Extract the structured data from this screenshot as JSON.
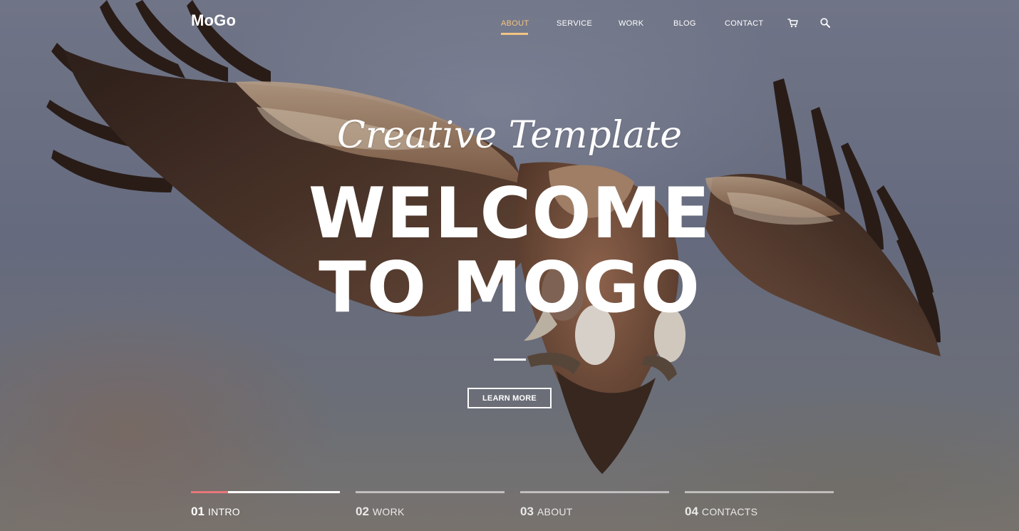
{
  "header": {
    "logo": "MoGo",
    "nav": [
      {
        "label": "ABOUT",
        "active": true
      },
      {
        "label": "SERVICE",
        "active": false
      },
      {
        "label": "WORK",
        "active": false
      },
      {
        "label": "BLOG",
        "active": false
      },
      {
        "label": "CONTACT",
        "active": false
      }
    ],
    "icons": [
      "cart-icon",
      "search-icon"
    ]
  },
  "hero": {
    "tagline": "Creative Template",
    "headline_line1": "WELCOME",
    "headline_line2": "TO MOGO",
    "button_label": "LEARN MORE"
  },
  "slides": [
    {
      "number": "01",
      "label": "INTRO",
      "active": true,
      "progress": 0.25
    },
    {
      "number": "02",
      "label": "WORK",
      "active": false
    },
    {
      "number": "03",
      "label": "ABOUT",
      "active": false
    },
    {
      "number": "04",
      "label": "CONTACTS",
      "active": false
    }
  ],
  "colors": {
    "accent": "#f3c483",
    "progress": "#e7777a",
    "text": "#ffffff"
  }
}
